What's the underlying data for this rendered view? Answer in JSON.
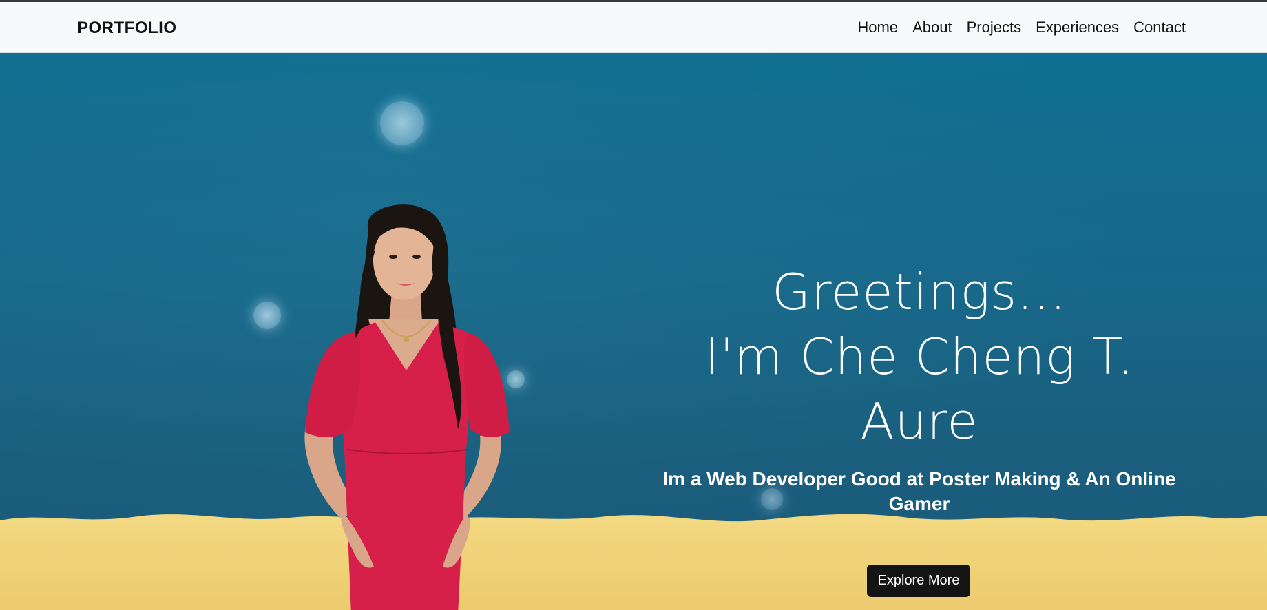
{
  "navbar": {
    "brand": "PORTFOLIO",
    "links": [
      {
        "label": "Home"
      },
      {
        "label": "About"
      },
      {
        "label": "Projects"
      },
      {
        "label": "Experiences"
      },
      {
        "label": "Contact"
      }
    ]
  },
  "hero": {
    "greeting_line1": "Greetings...",
    "greeting_line2": "I'm Che Cheng T. Aure",
    "tagline": "Im a Web Developer Good at Poster Making & An Online Gamer",
    "explore_label": "Explore More"
  },
  "colors": {
    "navbar_bg": "#f8f9fa",
    "sky": "#17688a",
    "sand": "#f1d27a",
    "dress": "#d61f49",
    "button_bg": "#141414"
  }
}
